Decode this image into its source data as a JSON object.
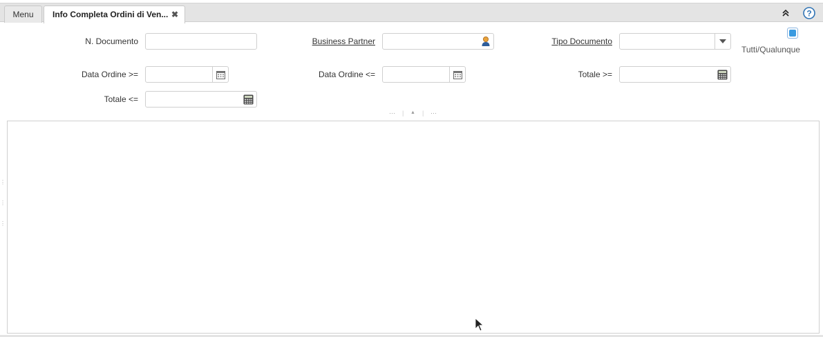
{
  "tabs": {
    "menu_label": "Menu",
    "active_label": "Info Completa Ordini di Ven...",
    "close_glyph": "✖"
  },
  "form": {
    "doc_number_label": "N. Documento",
    "doc_number_value": "",
    "business_partner_label": "Business Partner",
    "business_partner_value": "",
    "doc_type_label": "Tipo Documento",
    "doc_type_value": "",
    "order_date_from_label": "Data Ordine >=",
    "order_date_from_value": "",
    "order_date_to_label": "Data Ordine <=",
    "order_date_to_value": "",
    "total_from_label": "Totale >=",
    "total_from_value": "",
    "total_to_label": "Totale <=",
    "total_to_value": "",
    "all_any_label": "Tutti/Qualunque",
    "all_any_checked": true
  },
  "splitter": {
    "left_glyph": "···",
    "center_glyph": "▲",
    "right_glyph": "···"
  },
  "icons": {
    "collapse": "chevron-double-up-icon",
    "help": "help-circle-icon",
    "business_partner": "person-icon",
    "dropdown": "chevron-down-icon",
    "calendar": "calendar-icon",
    "calculator": "calculator-icon"
  },
  "colors": {
    "accent": "#3a9ae0",
    "help_blue": "#2f73b5",
    "tabbar_bg": "#e4e4e4",
    "border": "#cfcfcf"
  }
}
